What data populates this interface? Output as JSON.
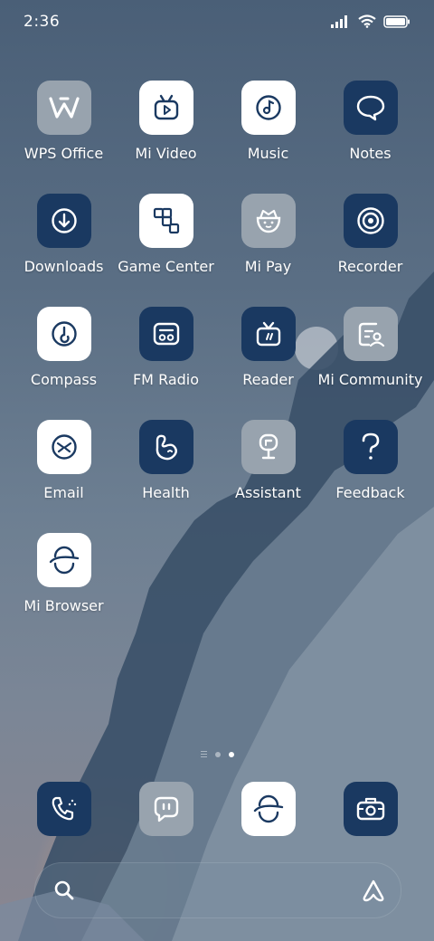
{
  "status_bar": {
    "time": "2:36"
  },
  "apps": [
    {
      "label": "WPS Office",
      "icon": "wps-office-icon",
      "style": "gray"
    },
    {
      "label": "Mi Video",
      "icon": "mi-video-icon",
      "style": "white"
    },
    {
      "label": "Music",
      "icon": "music-icon",
      "style": "white"
    },
    {
      "label": "Notes",
      "icon": "notes-icon",
      "style": "dark"
    },
    {
      "label": "Downloads",
      "icon": "downloads-icon",
      "style": "dark"
    },
    {
      "label": "Game Center",
      "icon": "game-center-icon",
      "style": "white"
    },
    {
      "label": "Mi Pay",
      "icon": "mi-pay-icon",
      "style": "gray"
    },
    {
      "label": "Recorder",
      "icon": "recorder-icon",
      "style": "dark"
    },
    {
      "label": "Compass",
      "icon": "compass-icon",
      "style": "white"
    },
    {
      "label": "FM Radio",
      "icon": "fm-radio-icon",
      "style": "dark"
    },
    {
      "label": "Reader",
      "icon": "reader-icon",
      "style": "dark"
    },
    {
      "label": "Mi Community",
      "icon": "mi-community-icon",
      "style": "gray"
    },
    {
      "label": "Email",
      "icon": "email-icon",
      "style": "white"
    },
    {
      "label": "Health",
      "icon": "health-icon",
      "style": "dark"
    },
    {
      "label": "Assistant",
      "icon": "assistant-icon",
      "style": "gray"
    },
    {
      "label": "Feedback",
      "icon": "feedback-icon",
      "style": "dark"
    },
    {
      "label": "Mi Browser",
      "icon": "mi-browser-icon",
      "style": "white"
    }
  ],
  "dock": [
    {
      "icon": "phone-icon",
      "style": "dark"
    },
    {
      "icon": "messaging-icon",
      "style": "gray"
    },
    {
      "icon": "browser-icon",
      "style": "white"
    },
    {
      "icon": "camera-icon",
      "style": "dark"
    }
  ],
  "pager": {
    "pages": 2,
    "active": 2
  },
  "colors": {
    "dark_tile": "#1a3961",
    "white_tile": "#ffffff",
    "gray_tile": "#98a3ae"
  }
}
